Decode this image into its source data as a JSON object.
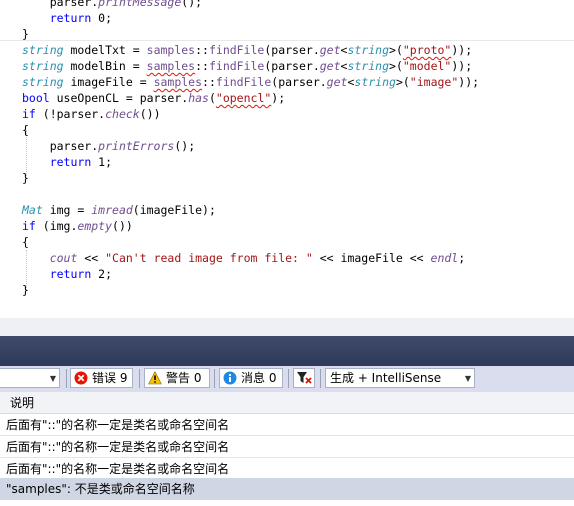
{
  "editor": {
    "lines": [
      [
        {
          "t": "    parser."
        },
        {
          "t": "printMessage",
          "c": "fn"
        },
        {
          "t": "();"
        }
      ],
      [
        {
          "t": "    "
        },
        {
          "t": "return",
          "c": "k"
        },
        {
          "t": " 0;"
        }
      ],
      [
        {
          "t": "}"
        }
      ],
      [
        {
          "t": "string",
          "c": "tp"
        },
        {
          "t": " modelTxt = "
        },
        {
          "t": "samples",
          "c": "ns"
        },
        {
          "t": "::"
        },
        {
          "t": "findFile",
          "c": "ns"
        },
        {
          "t": "(parser."
        },
        {
          "t": "get",
          "c": "fn"
        },
        {
          "t": "<"
        },
        {
          "t": "string",
          "c": "tp"
        },
        {
          "t": ">("
        },
        {
          "t": "\"proto\"",
          "c": "s sq"
        },
        {
          "t": "));"
        }
      ],
      [
        {
          "t": "string",
          "c": "tp"
        },
        {
          "t": " modelBin = "
        },
        {
          "t": "samples",
          "c": "ns sq"
        },
        {
          "t": "::"
        },
        {
          "t": "findFile",
          "c": "ns"
        },
        {
          "t": "(parser."
        },
        {
          "t": "get",
          "c": "fn"
        },
        {
          "t": "<"
        },
        {
          "t": "string",
          "c": "tp"
        },
        {
          "t": ">("
        },
        {
          "t": "\"model\"",
          "c": "s"
        },
        {
          "t": "));"
        }
      ],
      [
        {
          "t": "string",
          "c": "tp"
        },
        {
          "t": " imageFile = "
        },
        {
          "t": "samples",
          "c": "ns sq"
        },
        {
          "t": "::"
        },
        {
          "t": "findFile",
          "c": "ns"
        },
        {
          "t": "(parser."
        },
        {
          "t": "get",
          "c": "fn"
        },
        {
          "t": "<"
        },
        {
          "t": "string",
          "c": "tp"
        },
        {
          "t": ">("
        },
        {
          "t": "\"image\"",
          "c": "s"
        },
        {
          "t": "));"
        }
      ],
      [
        {
          "t": "bool",
          "c": "k"
        },
        {
          "t": " useOpenCL = parser."
        },
        {
          "t": "has",
          "c": "fn"
        },
        {
          "t": "("
        },
        {
          "t": "\"opencl\"",
          "c": "s sq"
        },
        {
          "t": ");"
        }
      ],
      [
        {
          "t": "if",
          "c": "k"
        },
        {
          "t": " (!parser."
        },
        {
          "t": "check",
          "c": "fn"
        },
        {
          "t": "())"
        }
      ],
      [
        {
          "t": "{"
        }
      ],
      [
        {
          "t": "    parser."
        },
        {
          "t": "printErrors",
          "c": "fn"
        },
        {
          "t": "();"
        }
      ],
      [
        {
          "t": "    "
        },
        {
          "t": "return",
          "c": "k"
        },
        {
          "t": " 1;"
        }
      ],
      [
        {
          "t": "}"
        }
      ],
      [
        {
          "t": ""
        }
      ],
      [
        {
          "t": "Mat",
          "c": "tp"
        },
        {
          "t": " img = "
        },
        {
          "t": "imread",
          "c": "fn"
        },
        {
          "t": "(imageFile);"
        }
      ],
      [
        {
          "t": "if",
          "c": "k"
        },
        {
          "t": " (img."
        },
        {
          "t": "empty",
          "c": "fn"
        },
        {
          "t": "())"
        }
      ],
      [
        {
          "t": "{"
        }
      ],
      [
        {
          "t": "    "
        },
        {
          "t": "cout",
          "c": "fn"
        },
        {
          "t": " << "
        },
        {
          "t": "\"Can't read image from file: \"",
          "c": "s"
        },
        {
          "t": " << imageFile << "
        },
        {
          "t": "endl",
          "c": "fn"
        },
        {
          "t": ";"
        }
      ],
      [
        {
          "t": "    "
        },
        {
          "t": "return",
          "c": "k"
        },
        {
          "t": " 2;"
        }
      ],
      [
        {
          "t": "}"
        }
      ]
    ]
  },
  "toolbar": {
    "errors_label": "错误 9",
    "warnings_label": "警告 0",
    "messages_label": "消息 0",
    "build_filter_value": "生成 + IntelliSense",
    "error_color": "#e51400",
    "warning_color": "#f6c300",
    "info_color": "#1e88e5"
  },
  "list": {
    "header": "说明",
    "rows": [
      "后面有\"::\"的名称一定是类名或命名空间名",
      "后面有\"::\"的名称一定是类名或命名空间名",
      "后面有\"::\"的名称一定是类名或命名空间名",
      "\"samples\": 不是类或命名空间名称"
    ]
  }
}
